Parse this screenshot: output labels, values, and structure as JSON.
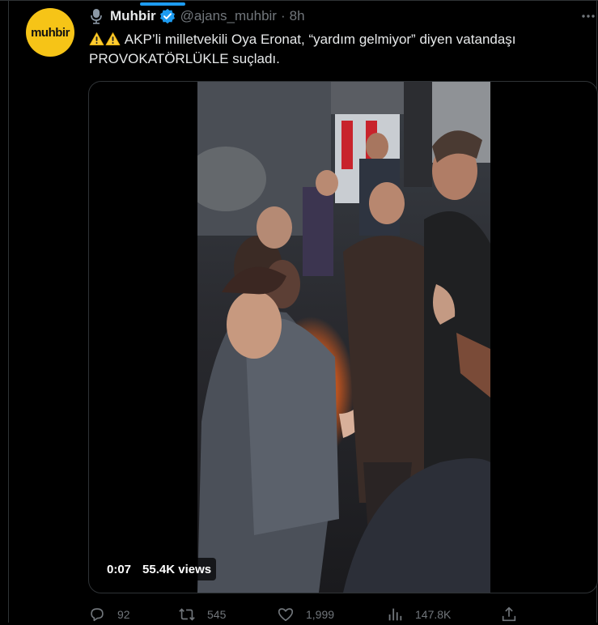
{
  "tweet": {
    "avatar_text": "muhbir",
    "author_name": "Muhbir",
    "author_handle": "@ajans_muhbir",
    "separator": "·",
    "time": "8h",
    "text_line1": "AKP’li milletvekili Oya Eronat, “yardım gelmiyor” diyen vatandaşı",
    "text_line2": "PROVOKATÖRLÜKLE suçladı.",
    "verified_color": "#1d9bf0",
    "warning_emoji_count": 2
  },
  "media": {
    "duration": "0:07",
    "views": "55.4K views"
  },
  "actions": {
    "replies": "92",
    "retweets": "545",
    "likes": "1,999",
    "views": "147.8K"
  },
  "icons": [
    "microphone-icon",
    "verified-badge-icon",
    "more-options-icon",
    "warning-icon",
    "reply-icon",
    "retweet-icon",
    "like-icon",
    "views-icon",
    "share-icon"
  ]
}
